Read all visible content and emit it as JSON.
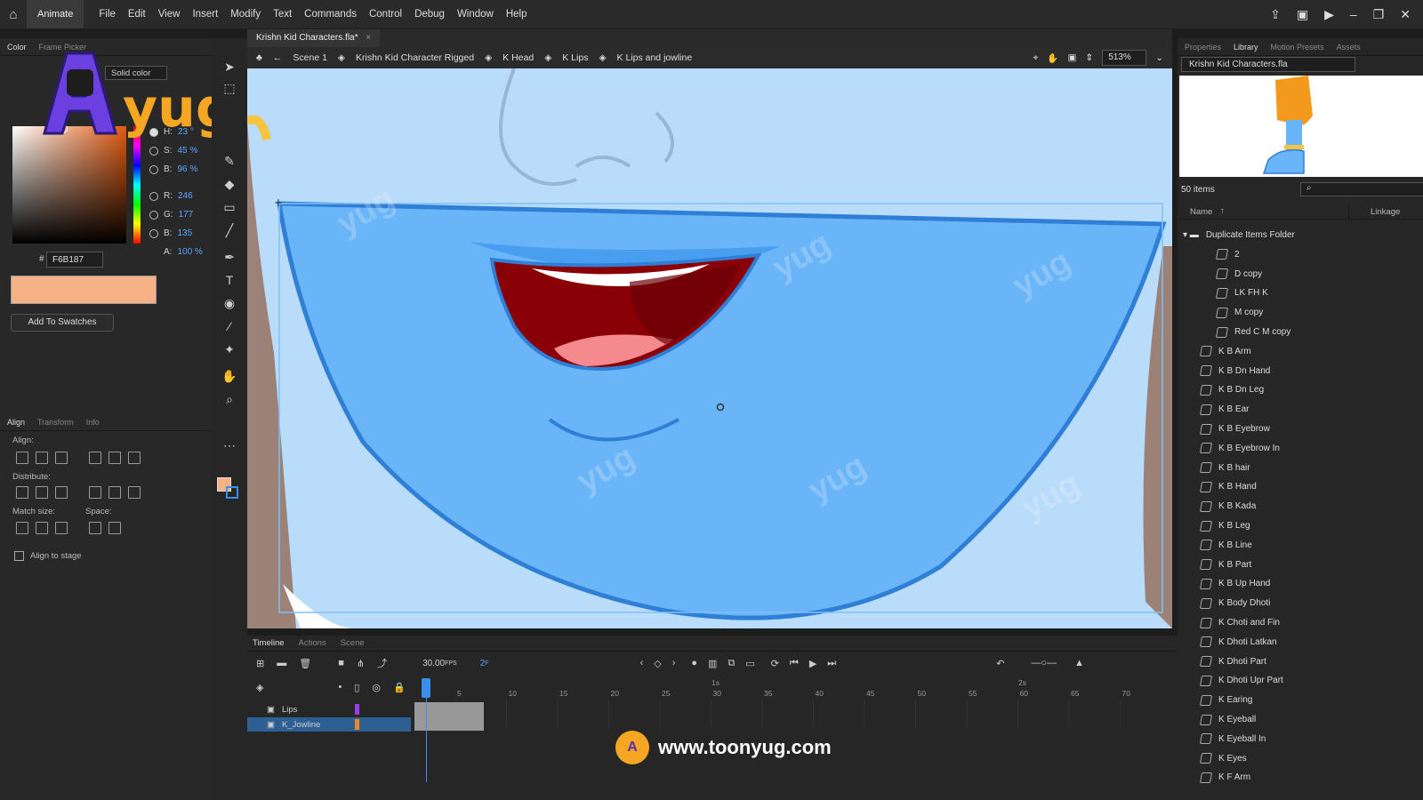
{
  "menubar": {
    "app_label": "Animate",
    "menus": [
      "File",
      "Edit",
      "View",
      "Insert",
      "Modify",
      "Text",
      "Commands",
      "Control",
      "Debug",
      "Window",
      "Help"
    ]
  },
  "color_panel": {
    "tabs": [
      "Color",
      "Frame Picker"
    ],
    "fill_type": "Solid color",
    "hsb": {
      "h_label": "H:",
      "h": "23 °",
      "s_label": "S:",
      "s": "45 %",
      "b_label": "B:",
      "b": "96 %"
    },
    "rgb": {
      "r_label": "R:",
      "r": "246",
      "g_label": "G:",
      "g": "177",
      "b_label": "B:",
      "b": "135"
    },
    "alpha_label": "A:",
    "alpha": "100 %",
    "hex_prefix": "#",
    "hex": "F6B187",
    "swatch_color": "#f6b187",
    "add_button": "Add To Swatches"
  },
  "align_panel": {
    "tabs": [
      "Align",
      "Transform",
      "Info"
    ],
    "align_label": "Align:",
    "distribute_label": "Distribute:",
    "match_label": "Match size:",
    "space_label": "Space:",
    "stage_label": "Align to stage"
  },
  "document": {
    "tab": "Krishn Kid Characters.fla*",
    "close": "×",
    "crumbs": [
      "Scene 1",
      "Krishn Kid Character Rigged",
      "K Head",
      "K Lips",
      "K Lips and jowline"
    ],
    "zoom": "513%"
  },
  "timeline": {
    "tabs": [
      "Timeline",
      "Actions",
      "Scene"
    ],
    "fps": "30.00",
    "fps_unit": "FPS",
    "frame": "2",
    "frame_unit": "F",
    "ruler": [
      "5",
      "10",
      "15",
      "20",
      "25",
      "30",
      "35",
      "40",
      "45",
      "50",
      "55",
      "60",
      "65",
      "70"
    ],
    "seconds": [
      "1s",
      "2s"
    ],
    "layers": [
      "Lips",
      "K_Jowline"
    ]
  },
  "right_panel": {
    "tabs": [
      "Properties",
      "Library",
      "Motion Presets",
      "Assets"
    ],
    "library_name": "Krishn Kid Characters.fla",
    "count": "50 items",
    "col_name": "Name",
    "col_linkage": "Linkage",
    "folder": "Duplicate Items Folder",
    "folder_items": [
      "2",
      "D copy",
      "LK FH K",
      "M copy",
      "Red C M copy"
    ],
    "items": [
      "K B Arm",
      "K B Dn Hand",
      "K B Dn Leg",
      "K B Ear",
      "K B Eyebrow",
      "K B Eyebrow In",
      "K B hair",
      "K B Hand",
      "K B Kada",
      "K B Leg",
      "K B Line",
      "K B Part",
      "K B Up Hand",
      "K Body Dhoti",
      "K Choti and Fin",
      "K Dhoti Latkan",
      "K Dhoti Part",
      "K Dhoti Upr Part",
      "K Earing",
      "K Eyeball",
      "K Eyeball In",
      "K Eyes",
      "K F Arm"
    ]
  },
  "watermark": {
    "text": "yug"
  },
  "footer": {
    "url": "www.toonyug.com"
  }
}
